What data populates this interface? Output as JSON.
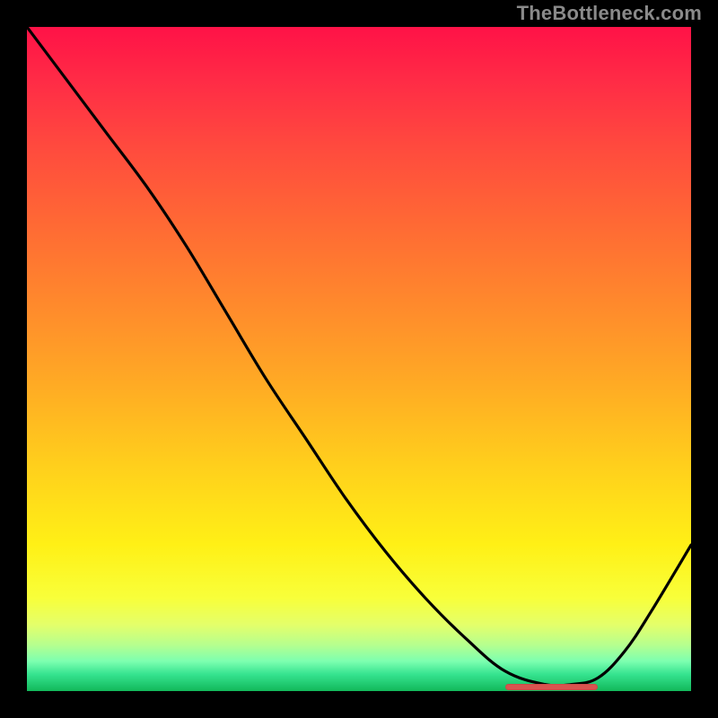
{
  "watermark": "TheBottleneck.com",
  "chart_data": {
    "type": "line",
    "title": "",
    "xlabel": "",
    "ylabel": "",
    "xlim": [
      0,
      100
    ],
    "ylim": [
      0,
      100
    ],
    "grid": false,
    "legend": false,
    "series": [
      {
        "name": "curve",
        "x": [
          0,
          6,
          12,
          18,
          24,
          30,
          36,
          42,
          48,
          54,
          60,
          66,
          72,
          78,
          82,
          86,
          90,
          94,
          100
        ],
        "y": [
          100,
          92,
          84,
          76,
          67,
          57,
          47,
          38,
          29,
          21,
          14,
          8,
          3,
          1,
          1,
          2,
          6,
          12,
          22
        ]
      }
    ],
    "annotations": [
      {
        "name": "optimal-marker",
        "x_start": 72,
        "x_end": 86,
        "y": 0.5
      }
    ],
    "background": "red-yellow-green vertical heat gradient"
  }
}
